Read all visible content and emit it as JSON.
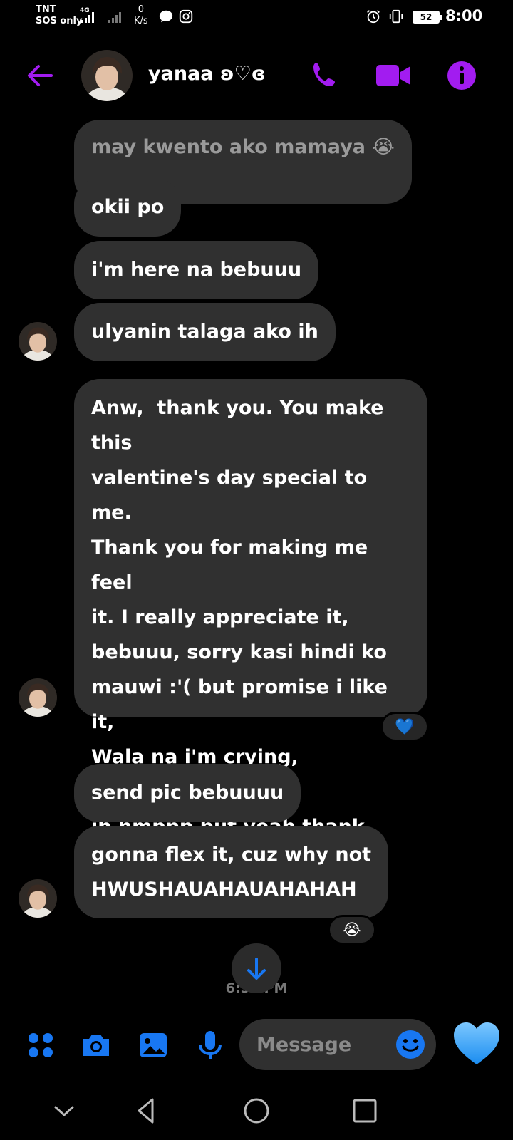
{
  "status_bar": {
    "carrier": "TNT",
    "sos": "SOS only",
    "network": "4G",
    "speed_value": "0",
    "speed_unit": "K/s",
    "battery": "52",
    "time": "8:00"
  },
  "header": {
    "contact_name": "yanaa ʚ♡ɞ"
  },
  "messages": [
    {
      "text": "may kwento ako mamaya 😭"
    },
    {
      "text": "okii po"
    },
    {
      "text": "i'm here na bebuuu"
    },
    {
      "text": "ulyanin talaga ako ih"
    },
    {
      "text": "Anw,  thank you. You make this\nvalentine's day special to me.\nThank you for making me feel\nit. I really appreciate it,\nbebuuu, sorry kasi hindi ko\nmauwi :'( but promise i like it,\nWala na i'm crying, emotional\nih hmppp but yeah thank you\nlovee!! 💗 :'("
    },
    {
      "text": "send pic bebuuuu"
    },
    {
      "text": "gonna flex it, cuz why not\nHWUSHAUAHAUAHAHAH"
    }
  ],
  "reactions": {
    "valentine": "💙",
    "flex": "😭"
  },
  "timestamp": "6:57 PM",
  "composer": {
    "placeholder": "Message",
    "like_emoji": "💙"
  },
  "colors": {
    "accent_purple": "#a21cf0",
    "accent_blue": "#1877f2",
    "bubble": "#303030",
    "background": "#000000"
  },
  "icons": {
    "status": [
      "alarm-icon",
      "vibrate-icon",
      "message-icon",
      "instagram-icon"
    ],
    "header": [
      "back-arrow-icon",
      "phone-icon",
      "video-camera-icon",
      "info-icon"
    ],
    "composer": [
      "apps-grid-icon",
      "camera-icon",
      "image-icon",
      "microphone-icon",
      "emoji-icon",
      "heart-icon"
    ],
    "navigation": [
      "chevron-down-icon",
      "back-triangle-icon",
      "home-circle-icon",
      "recents-square-icon"
    ]
  }
}
